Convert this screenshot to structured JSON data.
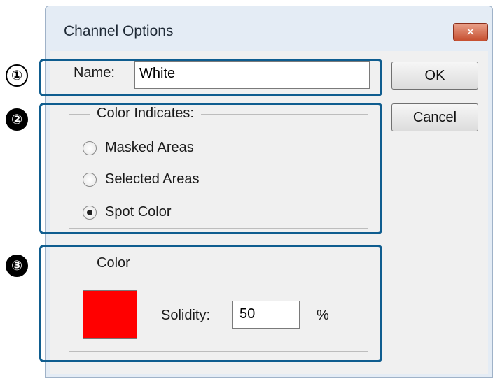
{
  "dialog": {
    "title": "Channel Options",
    "close_icon": "close-icon",
    "close_glyph": "✕"
  },
  "name_field": {
    "label": "Name:",
    "value": "White"
  },
  "buttons": {
    "ok": "OK",
    "cancel": "Cancel"
  },
  "color_indicates": {
    "legend": "Color Indicates:",
    "options": [
      {
        "label": "Masked Areas",
        "selected": false
      },
      {
        "label": "Selected Areas",
        "selected": false
      },
      {
        "label": "Spot Color",
        "selected": true
      }
    ]
  },
  "color_group": {
    "legend": "Color",
    "swatch_color": "#ff0000",
    "solidity_label": "Solidity:",
    "solidity_value": "50",
    "percent_sign": "%"
  },
  "callouts": [
    "①",
    "②",
    "③"
  ],
  "colors": {
    "callout_border": "#0f5d8f"
  }
}
